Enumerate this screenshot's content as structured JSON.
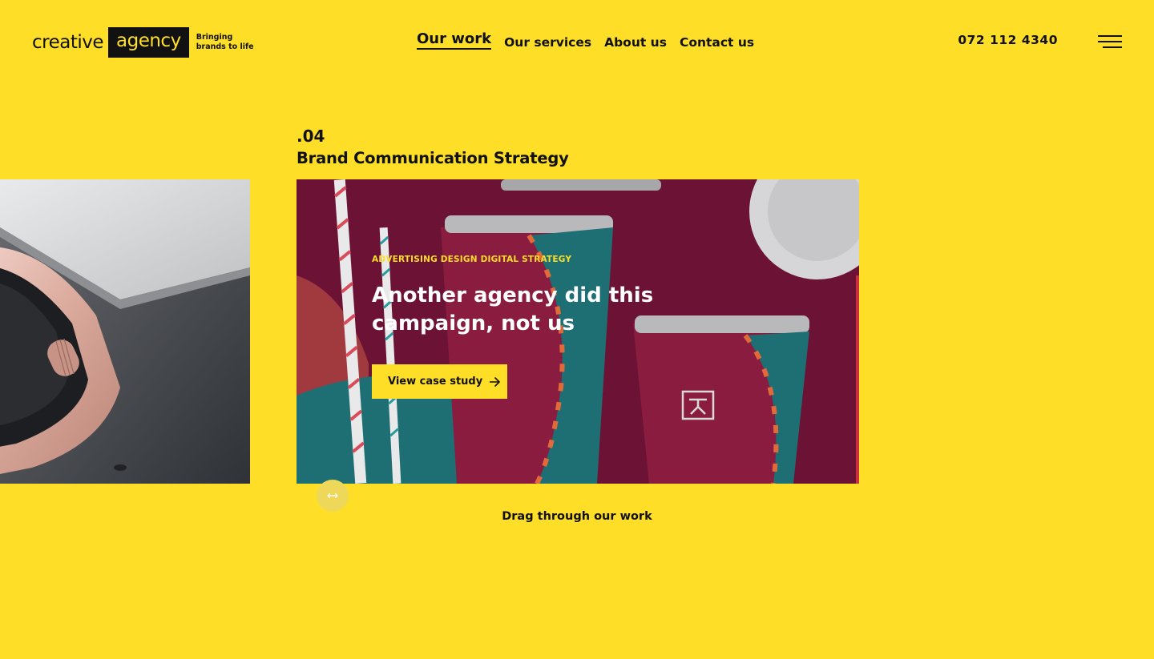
{
  "logo": {
    "word1": "creative",
    "word2": "agency",
    "tagline": "Bringing brands to life"
  },
  "nav": {
    "items": [
      {
        "label": "Our work",
        "active": true
      },
      {
        "label": "Our services",
        "active": false
      },
      {
        "label": "About us",
        "active": false
      },
      {
        "label": "Contact us",
        "active": false
      }
    ]
  },
  "phone": "072 112 4340",
  "menu_icon": "hamburger-icon",
  "project": {
    "number": ".04",
    "title": "Brand Communication Strategy",
    "tags": "ADVERTISING DESIGN DIGITAL STRATEGY",
    "headline": "Another agency did this campaign, not us",
    "cta_label": "View case study",
    "cta_icon": "arrow-right-icon"
  },
  "drag": {
    "icon": "drag-arrows-icon",
    "text": "Drag through our work"
  },
  "colors": {
    "background": "#FFDE27",
    "accent": "#FFDE27",
    "text": "#111111",
    "card_bg": "#6e1236"
  }
}
